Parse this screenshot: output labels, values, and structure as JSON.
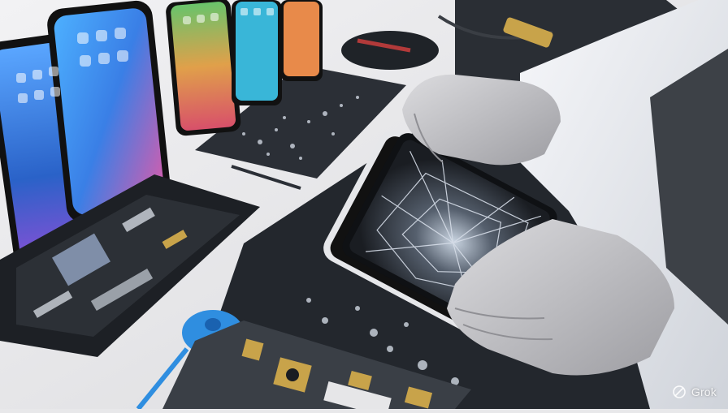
{
  "image": {
    "kind": "photo-illustration",
    "watermark": {
      "label": "Grok",
      "icon": "grok-logo-icon"
    }
  },
  "colors": {
    "background": "#e8e8ea",
    "mat": "#22262c",
    "glove": "#c9c9cc",
    "coat": "#eef0f4",
    "screen_blue": "#3b7fe0",
    "tool_blue": "#2f8ee0",
    "gold_part": "#c8a34a"
  }
}
